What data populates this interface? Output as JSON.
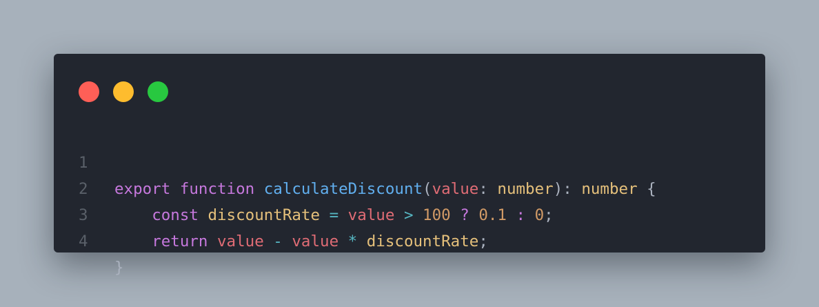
{
  "window_controls": [
    {
      "name": "close",
      "color": "#ff5f57"
    },
    {
      "name": "minimize",
      "color": "#febc2e"
    },
    {
      "name": "maximize",
      "color": "#28c840"
    }
  ],
  "code": {
    "line_numbers": [
      "1",
      "2",
      "3",
      "4"
    ],
    "lines": [
      [
        {
          "text": "export",
          "kind": "kw"
        },
        {
          "text": " ",
          "kind": "punc"
        },
        {
          "text": "function",
          "kind": "kw"
        },
        {
          "text": " ",
          "kind": "punc"
        },
        {
          "text": "calculateDiscount",
          "kind": "fn"
        },
        {
          "text": "(",
          "kind": "punc"
        },
        {
          "text": "value",
          "kind": "var"
        },
        {
          "text": ": ",
          "kind": "punc"
        },
        {
          "text": "number",
          "kind": "type"
        },
        {
          "text": "): ",
          "kind": "punc"
        },
        {
          "text": "number",
          "kind": "type"
        },
        {
          "text": " {",
          "kind": "punc"
        }
      ],
      [
        {
          "text": "    ",
          "kind": "punc"
        },
        {
          "text": "const",
          "kind": "kw"
        },
        {
          "text": " ",
          "kind": "punc"
        },
        {
          "text": "discountRate",
          "kind": "type"
        },
        {
          "text": " ",
          "kind": "punc"
        },
        {
          "text": "=",
          "kind": "op"
        },
        {
          "text": " ",
          "kind": "punc"
        },
        {
          "text": "value",
          "kind": "var"
        },
        {
          "text": " ",
          "kind": "punc"
        },
        {
          "text": ">",
          "kind": "op"
        },
        {
          "text": " ",
          "kind": "punc"
        },
        {
          "text": "100",
          "kind": "num"
        },
        {
          "text": " ",
          "kind": "punc"
        },
        {
          "text": "?",
          "kind": "kw"
        },
        {
          "text": " ",
          "kind": "punc"
        },
        {
          "text": "0.1",
          "kind": "num"
        },
        {
          "text": " ",
          "kind": "punc"
        },
        {
          "text": ":",
          "kind": "kw"
        },
        {
          "text": " ",
          "kind": "punc"
        },
        {
          "text": "0",
          "kind": "num"
        },
        {
          "text": ";",
          "kind": "punc"
        }
      ],
      [
        {
          "text": "    ",
          "kind": "punc"
        },
        {
          "text": "return",
          "kind": "kw"
        },
        {
          "text": " ",
          "kind": "punc"
        },
        {
          "text": "value",
          "kind": "var"
        },
        {
          "text": " ",
          "kind": "punc"
        },
        {
          "text": "-",
          "kind": "op"
        },
        {
          "text": " ",
          "kind": "punc"
        },
        {
          "text": "value",
          "kind": "var"
        },
        {
          "text": " ",
          "kind": "punc"
        },
        {
          "text": "*",
          "kind": "op"
        },
        {
          "text": " ",
          "kind": "punc"
        },
        {
          "text": "discountRate",
          "kind": "type"
        },
        {
          "text": ";",
          "kind": "punc"
        }
      ],
      [
        {
          "text": "}",
          "kind": "punc"
        }
      ]
    ]
  },
  "syntax_colors": {
    "kw": "#c678dd",
    "fn": "#61afef",
    "var": "#e06c75",
    "type": "#e5c07b",
    "num": "#d19a66",
    "op": "#56b6c2",
    "punc": "#abb2bf"
  }
}
